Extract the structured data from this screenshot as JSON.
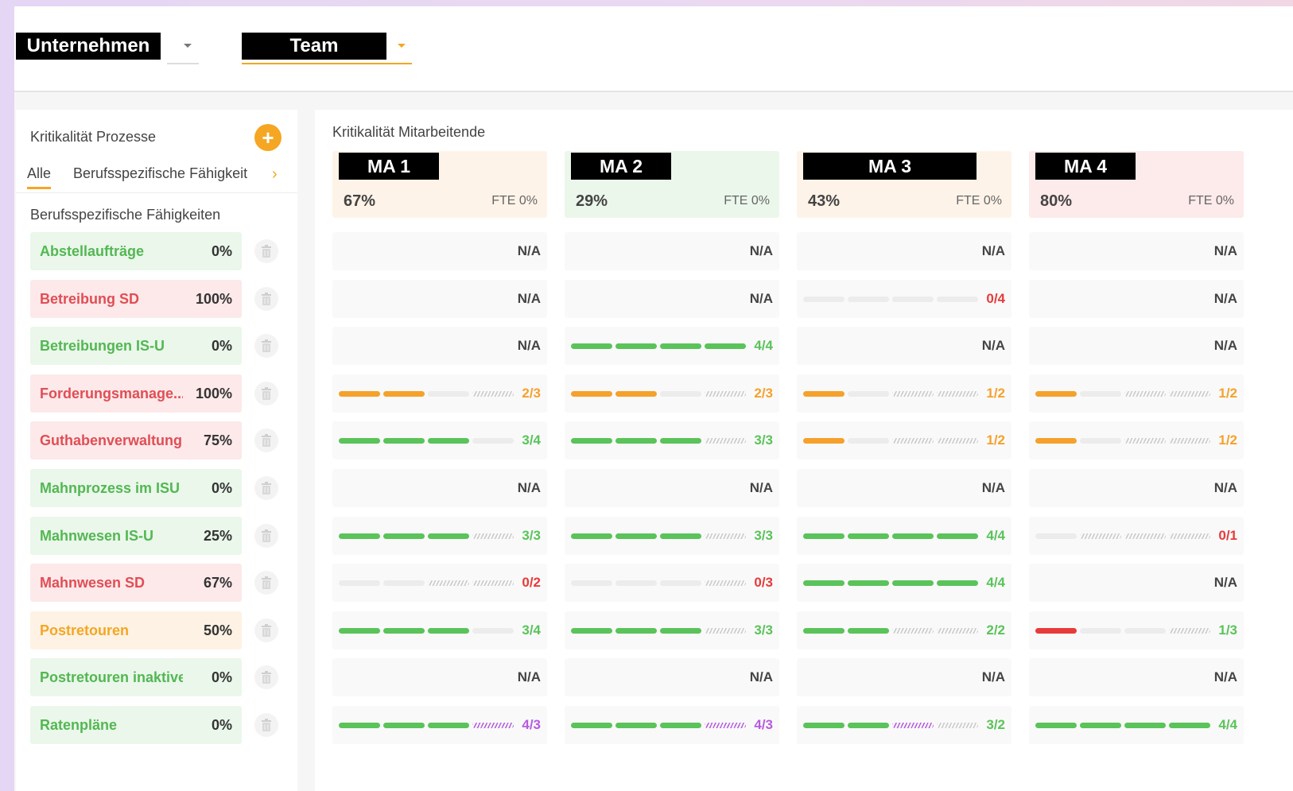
{
  "colors": {
    "accent": "#f5a623",
    "green": "#5ac35a",
    "orange": "#f5a12c",
    "red": "#e83a3a",
    "purple": "#b75be0"
  },
  "topbar": {
    "company_select": "Unternehmen",
    "team_select": "Team"
  },
  "left_panel": {
    "title": "Kritikalität Prozesse",
    "add_icon": "plus-icon",
    "tab_all": "Alle",
    "tab_skill": "Berufsspezifische Fähigkeit",
    "section_title": "Berufsspezifische Fähigkeiten",
    "skills": [
      {
        "name": "Abstellaufträge",
        "pct": "0%",
        "status": "green"
      },
      {
        "name": "Betreibung SD",
        "pct": "100%",
        "status": "red"
      },
      {
        "name": "Betreibungen IS-U",
        "pct": "0%",
        "status": "green"
      },
      {
        "name": "Forderungsmanage...",
        "pct": "100%",
        "status": "red"
      },
      {
        "name": "Guthabenverwaltung",
        "pct": "75%",
        "status": "red"
      },
      {
        "name": "Mahnprozess im ISU",
        "pct": "0%",
        "status": "green"
      },
      {
        "name": "Mahnwesen IS-U",
        "pct": "25%",
        "status": "green"
      },
      {
        "name": "Mahnwesen SD",
        "pct": "67%",
        "status": "red"
      },
      {
        "name": "Postretouren",
        "pct": "50%",
        "status": "orange"
      },
      {
        "name": "Postretouren inaktive ...",
        "pct": "0%",
        "status": "green"
      },
      {
        "name": "Ratenpläne",
        "pct": "0%",
        "status": "green"
      }
    ]
  },
  "main": {
    "title": "Kritikalität Mitarbeitende",
    "columns": [
      {
        "label": "MA 1",
        "pct": "67%",
        "fte": "FTE 0%",
        "bg": "#fef3e8",
        "cells": [
          {
            "text": "N/A"
          },
          {
            "text": "N/A"
          },
          {
            "text": "N/A"
          },
          {
            "text": "2/3",
            "color": "#f5a12c",
            "segs": [
              "o",
              "o",
              "e",
              "h"
            ]
          },
          {
            "text": "3/4",
            "color": "#5ac35a",
            "segs": [
              "g",
              "g",
              "g",
              "e"
            ]
          },
          {
            "text": "N/A"
          },
          {
            "text": "3/3",
            "color": "#5ac35a",
            "segs": [
              "g",
              "g",
              "g",
              "h"
            ]
          },
          {
            "text": "0/2",
            "color": "#e83a3a",
            "segs": [
              "e",
              "e",
              "h",
              "h"
            ]
          },
          {
            "text": "3/4",
            "color": "#5ac35a",
            "segs": [
              "g",
              "g",
              "g",
              "e"
            ]
          },
          {
            "text": "N/A"
          },
          {
            "text": "4/3",
            "color": "#b75be0",
            "segs": [
              "g",
              "g",
              "g",
              "p"
            ]
          }
        ]
      },
      {
        "label": "MA 2",
        "pct": "29%",
        "fte": "FTE 0%",
        "bg": "#ebf7ea",
        "cells": [
          {
            "text": "N/A"
          },
          {
            "text": "N/A"
          },
          {
            "text": "4/4",
            "color": "#5ac35a",
            "segs": [
              "g",
              "g",
              "g",
              "g"
            ]
          },
          {
            "text": "2/3",
            "color": "#f5a12c",
            "segs": [
              "o",
              "o",
              "e",
              "h"
            ]
          },
          {
            "text": "3/3",
            "color": "#5ac35a",
            "segs": [
              "g",
              "g",
              "g",
              "h"
            ]
          },
          {
            "text": "N/A"
          },
          {
            "text": "3/3",
            "color": "#5ac35a",
            "segs": [
              "g",
              "g",
              "g",
              "h"
            ]
          },
          {
            "text": "0/3",
            "color": "#e83a3a",
            "segs": [
              "e",
              "e",
              "e",
              "h"
            ]
          },
          {
            "text": "3/3",
            "color": "#5ac35a",
            "segs": [
              "g",
              "g",
              "g",
              "h"
            ]
          },
          {
            "text": "N/A"
          },
          {
            "text": "4/3",
            "color": "#b75be0",
            "segs": [
              "g",
              "g",
              "g",
              "p"
            ]
          }
        ]
      },
      {
        "label": "MA 3",
        "pct": "43%",
        "fte": "FTE 0%",
        "bg": "#fef3e8",
        "cells": [
          {
            "text": "N/A"
          },
          {
            "text": "0/4",
            "color": "#e83a3a",
            "segs": [
              "e",
              "e",
              "e",
              "e"
            ]
          },
          {
            "text": "N/A"
          },
          {
            "text": "1/2",
            "color": "#f5a12c",
            "segs": [
              "o",
              "e",
              "h",
              "h"
            ]
          },
          {
            "text": "1/2",
            "color": "#f5a12c",
            "segs": [
              "o",
              "e",
              "h",
              "h"
            ]
          },
          {
            "text": "N/A"
          },
          {
            "text": "4/4",
            "color": "#5ac35a",
            "segs": [
              "g",
              "g",
              "g",
              "g"
            ]
          },
          {
            "text": "4/4",
            "color": "#5ac35a",
            "segs": [
              "g",
              "g",
              "g",
              "g"
            ]
          },
          {
            "text": "2/2",
            "color": "#5ac35a",
            "segs": [
              "g",
              "g",
              "h",
              "h"
            ]
          },
          {
            "text": "N/A"
          },
          {
            "text": "3/2",
            "color": "#5ac35a",
            "segs": [
              "g",
              "g",
              "p",
              "h"
            ]
          }
        ]
      },
      {
        "label": "MA 4",
        "pct": "80%",
        "fte": "FTE 0%",
        "bg": "#fdeaea",
        "cells": [
          {
            "text": "N/A"
          },
          {
            "text": "N/A"
          },
          {
            "text": "N/A"
          },
          {
            "text": "1/2",
            "color": "#f5a12c",
            "segs": [
              "o",
              "e",
              "h",
              "h"
            ]
          },
          {
            "text": "1/2",
            "color": "#f5a12c",
            "segs": [
              "o",
              "e",
              "h",
              "h"
            ]
          },
          {
            "text": "N/A"
          },
          {
            "text": "0/1",
            "color": "#e83a3a",
            "segs": [
              "e",
              "h",
              "h",
              "h"
            ]
          },
          {
            "text": "N/A"
          },
          {
            "text": "1/3",
            "color": "#5ac35a",
            "segs": [
              "r",
              "e",
              "e",
              "h"
            ]
          },
          {
            "text": "N/A"
          },
          {
            "text": "4/4",
            "color": "#5ac35a",
            "segs": [
              "g",
              "g",
              "g",
              "g"
            ]
          }
        ]
      }
    ]
  }
}
